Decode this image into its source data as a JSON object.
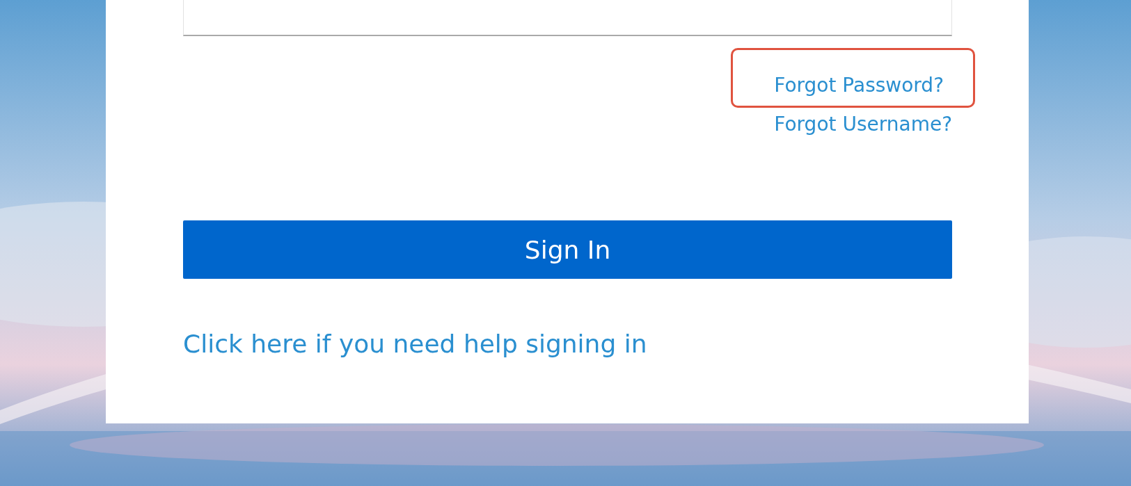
{
  "links": [
    {
      "label": "Forgot Password?",
      "highlighted": true
    },
    {
      "label": "Forgot Username?",
      "highlighted": false
    }
  ],
  "sign_in_button": {
    "label": "Sign In"
  },
  "help_link": {
    "label": "Click here if you need help signing in"
  }
}
